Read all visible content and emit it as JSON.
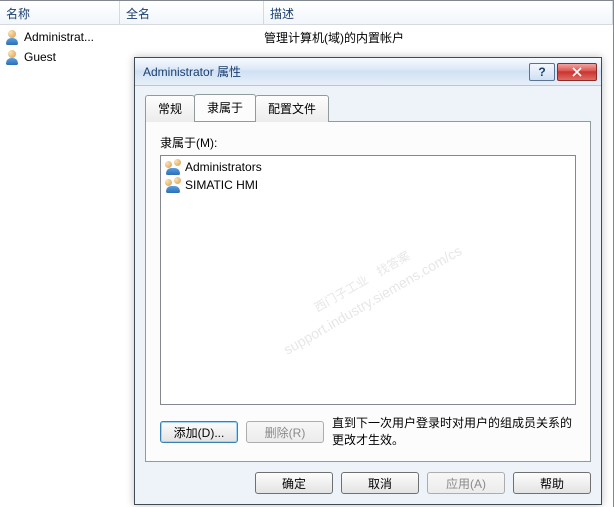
{
  "columns": {
    "name": "名称",
    "fullname": "全名",
    "desc": "描述"
  },
  "users": [
    {
      "name": "Administrat...",
      "fullname": "",
      "desc": "管理计算机(域)的内置帐户"
    },
    {
      "name": "Guest",
      "fullname": "",
      "desc": ""
    }
  ],
  "dialog": {
    "title": "Administrator 属性",
    "tabs": {
      "general": "常规",
      "memberof": "隶属于",
      "profile": "配置文件"
    },
    "active_tab": "memberof",
    "memberof_label": "隶属于(M):",
    "groups": [
      "Administrators",
      "SIMATIC HMI"
    ],
    "add": "添加(D)...",
    "remove": "删除(R)",
    "note": "直到下一次用户登录时对用户的组成员关系的更改才生效。",
    "ok": "确定",
    "cancel": "取消",
    "apply": "应用(A)",
    "help": "帮助"
  },
  "watermark": {
    "line1": "西门子工业　找答案",
    "line2": "support.industry.siemens.com/cs"
  }
}
